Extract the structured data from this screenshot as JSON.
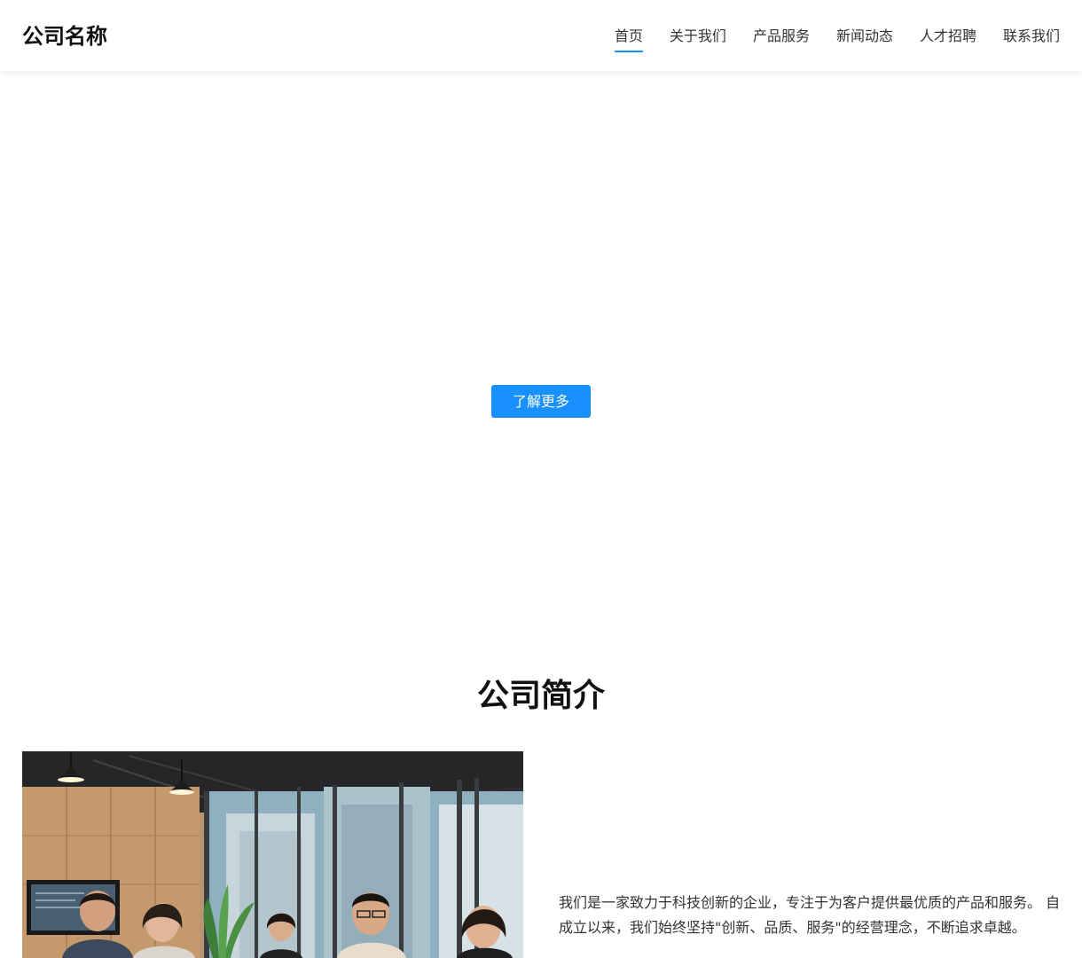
{
  "header": {
    "logo": "公司名称",
    "nav": [
      {
        "label": "首页",
        "active": true
      },
      {
        "label": "关于我们",
        "active": false
      },
      {
        "label": "产品服务",
        "active": false
      },
      {
        "label": "新闻动态",
        "active": false
      },
      {
        "label": "人才招聘",
        "active": false
      },
      {
        "label": "联系我们",
        "active": false
      }
    ]
  },
  "hero": {
    "button_label": "了解更多"
  },
  "about": {
    "title": "公司简介",
    "paragraph": "我们是一家致力于科技创新的企业，专注于为客户提供最优质的产品和服务。 自成立以来，我们始终坚持\"创新、品质、服务\"的经营理念，不断追求卓越。"
  },
  "colors": {
    "accent": "#1890ff"
  }
}
